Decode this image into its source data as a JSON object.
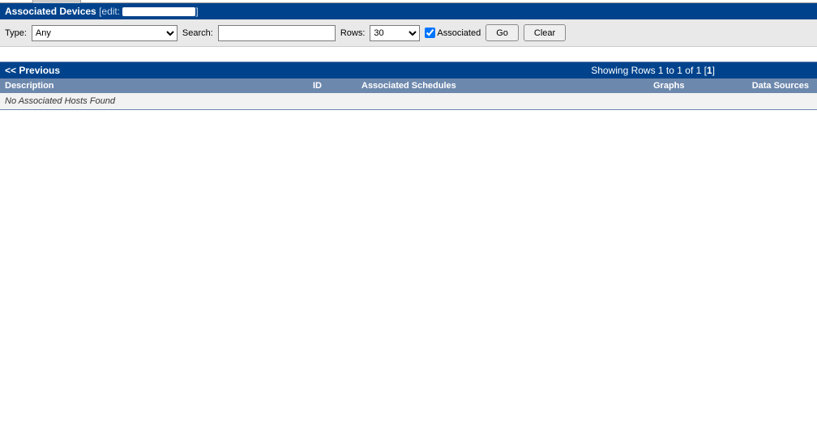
{
  "title": {
    "main": "Associated Devices",
    "edit_prefix": " [edit: ",
    "edit_suffix": "]"
  },
  "filter": {
    "type_label": "Type:",
    "type_value": "Any",
    "search_label": "Search:",
    "search_value": "",
    "rows_label": "Rows:",
    "rows_value": "30",
    "associated_label": "Associated",
    "go_label": "Go",
    "clear_label": "Clear"
  },
  "pager": {
    "previous": "<< Previous",
    "showing_prefix": "Showing Rows 1 to 1 of 1 [",
    "showing_page": "1",
    "showing_suffix": "]"
  },
  "columns": {
    "description": "Description",
    "id": "ID",
    "schedules": "Associated Schedules",
    "graphs": "Graphs",
    "sources": "Data Sources"
  },
  "empty": "No Associated Hosts Found"
}
